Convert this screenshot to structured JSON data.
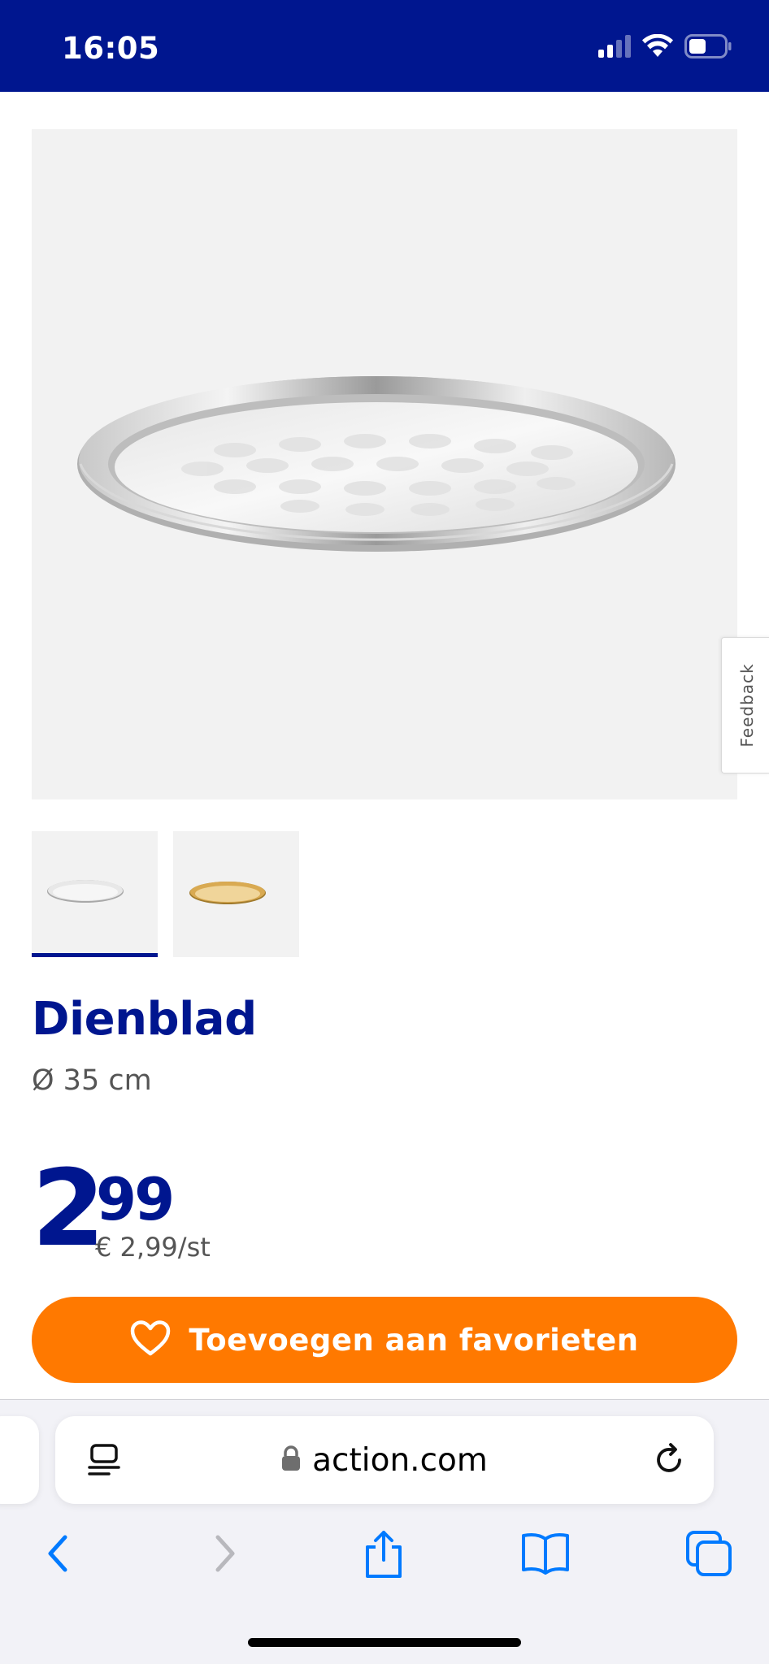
{
  "status_bar": {
    "time": "16:05",
    "icons": [
      "cellular-signal-icon",
      "wifi-icon",
      "battery-icon"
    ],
    "background_color": "#00168f"
  },
  "product": {
    "title": "Dienblad",
    "subtitle": "Ø 35 cm",
    "images": [
      {
        "name": "silver-tray-thumbnail",
        "selected": true
      },
      {
        "name": "gold-tray-thumbnail",
        "selected": false
      }
    ]
  },
  "price": {
    "integer": "2",
    "decimal": "99",
    "unit_price": "€ 2,99/st"
  },
  "favorite_button": {
    "label": "Toevoegen aan favorieten",
    "icon": "heart-outline-icon",
    "color": "#ff7900"
  },
  "feedback_tab": {
    "label": "Feedback"
  },
  "browser": {
    "url": "action.com",
    "toolbar": [
      "back-icon",
      "forward-icon",
      "share-icon",
      "bookmarks-icon",
      "tabs-icon"
    ],
    "accent_color": "#007aff"
  },
  "brand_color": "#00168f"
}
